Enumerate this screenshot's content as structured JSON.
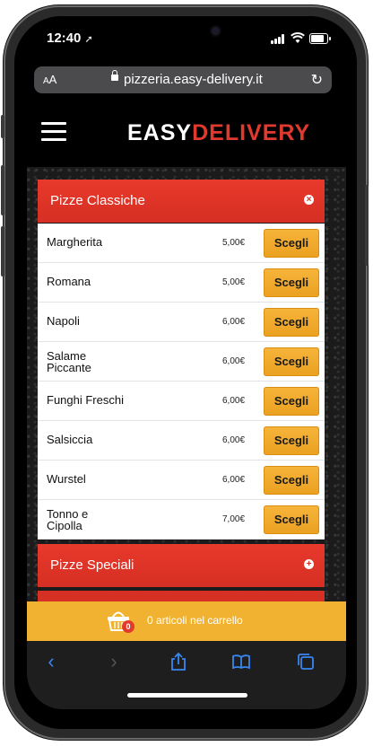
{
  "status": {
    "time": "12:40"
  },
  "browser": {
    "text_size": "AA",
    "url": "pizzeria.easy-delivery.it",
    "reload_icon": "reload-icon"
  },
  "site": {
    "logo_part1": "EASY",
    "logo_part2": "DELIVERY",
    "logo_accent": "#e03a2f",
    "menu_icon": "hamburger-icon"
  },
  "categories": [
    {
      "name": "Pizze Classiche",
      "state": "expanded",
      "icon": "close-circle-icon"
    },
    {
      "name": "Pizze Speciali",
      "state": "collapsed",
      "icon": "plus-circle-icon"
    }
  ],
  "items": [
    {
      "name": "Margherita",
      "price": "5,00€",
      "button": "Scegli"
    },
    {
      "name": "Romana",
      "price": "5,00€",
      "button": "Scegli"
    },
    {
      "name": "Napoli",
      "price": "6,00€",
      "button": "Scegli"
    },
    {
      "name": "Salame\nPiccante",
      "price": "6,00€",
      "button": "Scegli"
    },
    {
      "name": "Funghi Freschi",
      "price": "6,00€",
      "button": "Scegli"
    },
    {
      "name": "Salsiccia",
      "price": "6,00€",
      "button": "Scegli"
    },
    {
      "name": "Wurstel",
      "price": "6,00€",
      "button": "Scegli"
    },
    {
      "name": "Tonno e\nCipolla",
      "price": "7,00€",
      "button": "Scegli"
    }
  ],
  "cart": {
    "count": "0",
    "text": "0 articoli nel carrello",
    "bar_color": "#f1b232"
  },
  "toolbar": {
    "icons": [
      "back-icon",
      "forward-icon",
      "share-icon",
      "bookmarks-icon",
      "tabs-icon"
    ],
    "accent": "#3a86f0"
  }
}
